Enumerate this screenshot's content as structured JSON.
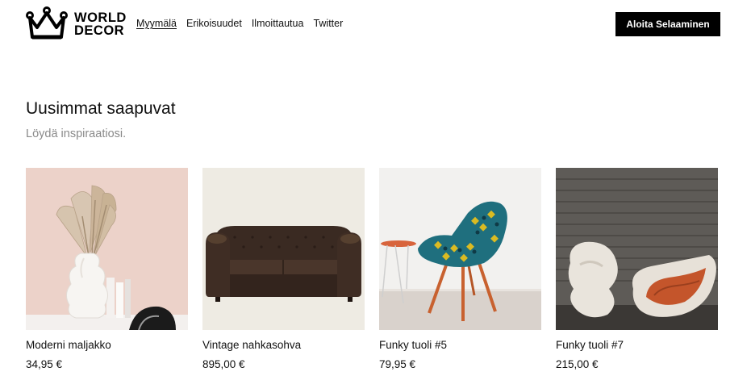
{
  "brand": {
    "line1": "WORLD",
    "line2": "DECOR",
    "icon": "crown-icon"
  },
  "nav": {
    "items": [
      {
        "label": "Myymälä",
        "active": true
      },
      {
        "label": "Erikoisuudet",
        "active": false
      },
      {
        "label": "Ilmoittautua",
        "active": false
      },
      {
        "label": "Twitter",
        "active": false
      }
    ]
  },
  "header": {
    "cta_label": "Aloita Selaaminen"
  },
  "section": {
    "title": "Uusimmat saapuvat",
    "subtitle": "Löydä inspiraatiosi."
  },
  "products": [
    {
      "name": "Moderni maljakko",
      "price": "34,95 €",
      "image": "vase-photo"
    },
    {
      "name": "Vintage nahkasohva",
      "price": "895,00 €",
      "image": "sofa-photo"
    },
    {
      "name": "Funky tuoli #5",
      "price": "79,95 €",
      "image": "chair-photo"
    },
    {
      "name": "Funky tuoli #7",
      "price": "215,00 €",
      "image": "lounge-chairs-photo"
    }
  ],
  "colors": {
    "accent": "#000000",
    "subtitle": "#8a8a8a",
    "background": "#ffffff"
  }
}
